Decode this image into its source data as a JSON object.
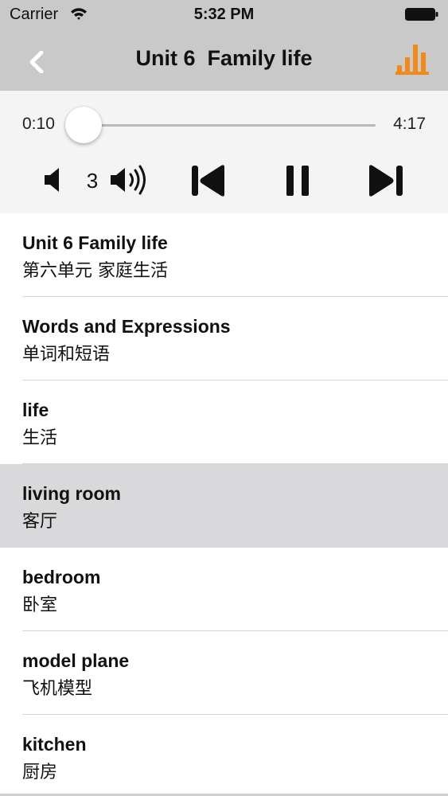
{
  "status_bar": {
    "carrier": "Carrier",
    "time": "5:32 PM",
    "icons": [
      "wifi-icon",
      "battery-icon"
    ]
  },
  "nav": {
    "title": "Unit 6  Family life",
    "back_icon": "chevron-left-icon",
    "right_icon": "equalizer-bars-icon",
    "accent_color": "#f08a1c"
  },
  "player": {
    "current_time": "0:10",
    "total_time": "4:17",
    "progress_fraction": 0.04,
    "progress_color": "#2f9fd8",
    "volume_level": "3",
    "icons": [
      "volume-down-icon",
      "volume-up-icon",
      "skip-previous-icon",
      "pause-icon",
      "skip-next-icon"
    ]
  },
  "list": {
    "items": [
      {
        "en": "Unit 6 Family life",
        "cn": "第六单元 家庭生活",
        "selected": false
      },
      {
        "en": "Words and Expressions",
        "cn": "单词和短语",
        "selected": false
      },
      {
        "en": "life",
        "cn": "生活",
        "selected": false
      },
      {
        "en": "living room",
        "cn": "客厅",
        "selected": true
      },
      {
        "en": "bedroom",
        "cn": "卧室",
        "selected": false
      },
      {
        "en": "model plane",
        "cn": "飞机模型",
        "selected": false
      },
      {
        "en": "kitchen",
        "cn": "厨房",
        "selected": false
      }
    ]
  }
}
